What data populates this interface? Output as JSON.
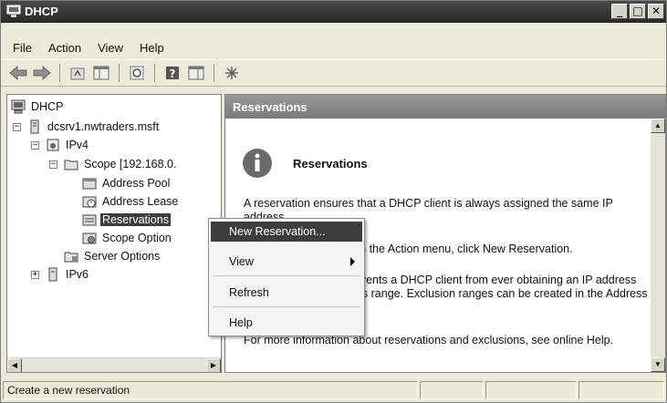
{
  "window": {
    "title": "DHCP"
  },
  "window_buttons": {
    "minimize": "_",
    "maximize": "□",
    "close": "✕"
  },
  "menubar": {
    "items": [
      "File",
      "Action",
      "View",
      "Help"
    ]
  },
  "toolbar": {
    "icons": [
      "back-arrow-icon",
      "forward-arrow-icon",
      "up-folder-icon",
      "show-hide-tree-icon",
      "refresh-icon",
      "help-icon",
      "export-list-icon",
      "dhcp-server-icon"
    ]
  },
  "tree": {
    "root": "DHCP",
    "server": "dcsrv1.nwtraders.msft",
    "ipv4": "IPv4",
    "scope": "Scope [192.168.0.",
    "address_pool": "Address Pool",
    "address_leases": "Address Lease",
    "reservations": "Reservations",
    "scope_options": "Scope Option",
    "server_options": "Server Options",
    "ipv6": "IPv6"
  },
  "content": {
    "header": "Reservations",
    "title": "Reservations",
    "paragraph1": "A reservation ensures that a DHCP client is always assigned the same IP address.",
    "paragraph2": "To add a reservation, on the Action menu, click New Reservation.",
    "paragraph3": "An exclusion range prevents a DHCP client from ever obtaining an IP address from a specified address range. Exclusion ranges can be created in the Address Pool.",
    "paragraph4": "For more information about reservations and exclusions, see online Help."
  },
  "context_menu": {
    "new_reservation": "New Reservation...",
    "view": "View",
    "refresh": "Refresh",
    "help": "Help"
  },
  "statusbar": {
    "text": "Create a new reservation"
  },
  "colors": {
    "selection": "#3d3d3d",
    "titlebar": "#2a2a2a",
    "header": "#8a8a8a"
  }
}
